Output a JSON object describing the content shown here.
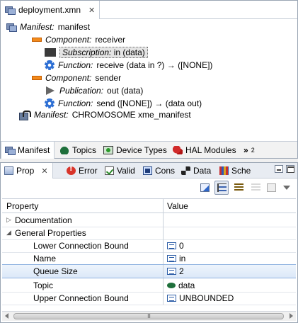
{
  "editor": {
    "tab_title": "deployment.xmn",
    "tree": [
      {
        "kind": "Manifest:",
        "name": "manifest"
      },
      {
        "kind": "Component:",
        "name": "receiver"
      },
      {
        "kind": "Subscription:",
        "name": "in (data)"
      },
      {
        "kind": "Function:",
        "name": "receive (data in ?) → ([NONE])"
      },
      {
        "kind": "Component:",
        "name": "sender"
      },
      {
        "kind": "Publication:",
        "name": "out (data)"
      },
      {
        "kind": "Function:",
        "name": "send ([NONE]) → (data out)"
      },
      {
        "kind": "Manifest:",
        "name": "CHROMOSOME xme_manifest"
      }
    ],
    "view_tabs": [
      "Manifest",
      "Topics",
      "Device Types",
      "HAL Modules"
    ],
    "more_tabs": "»",
    "more_count": "2"
  },
  "properties_view": {
    "tabs": [
      "Prop",
      "Error",
      "Valid",
      "Cons",
      "Data",
      "Sche"
    ],
    "columns": [
      "Property",
      "Value"
    ],
    "rows": [
      {
        "property": "Documentation",
        "value": ""
      },
      {
        "property": "General Properties",
        "value": ""
      },
      {
        "property": "Lower Connection Bound",
        "value": "0"
      },
      {
        "property": "Name",
        "value": "in"
      },
      {
        "property": "Queue Size",
        "value": "2"
      },
      {
        "property": "Topic",
        "value": "data"
      },
      {
        "property": "Upper Connection Bound",
        "value": "UNBOUNDED"
      }
    ],
    "scroll_grip": "III"
  }
}
